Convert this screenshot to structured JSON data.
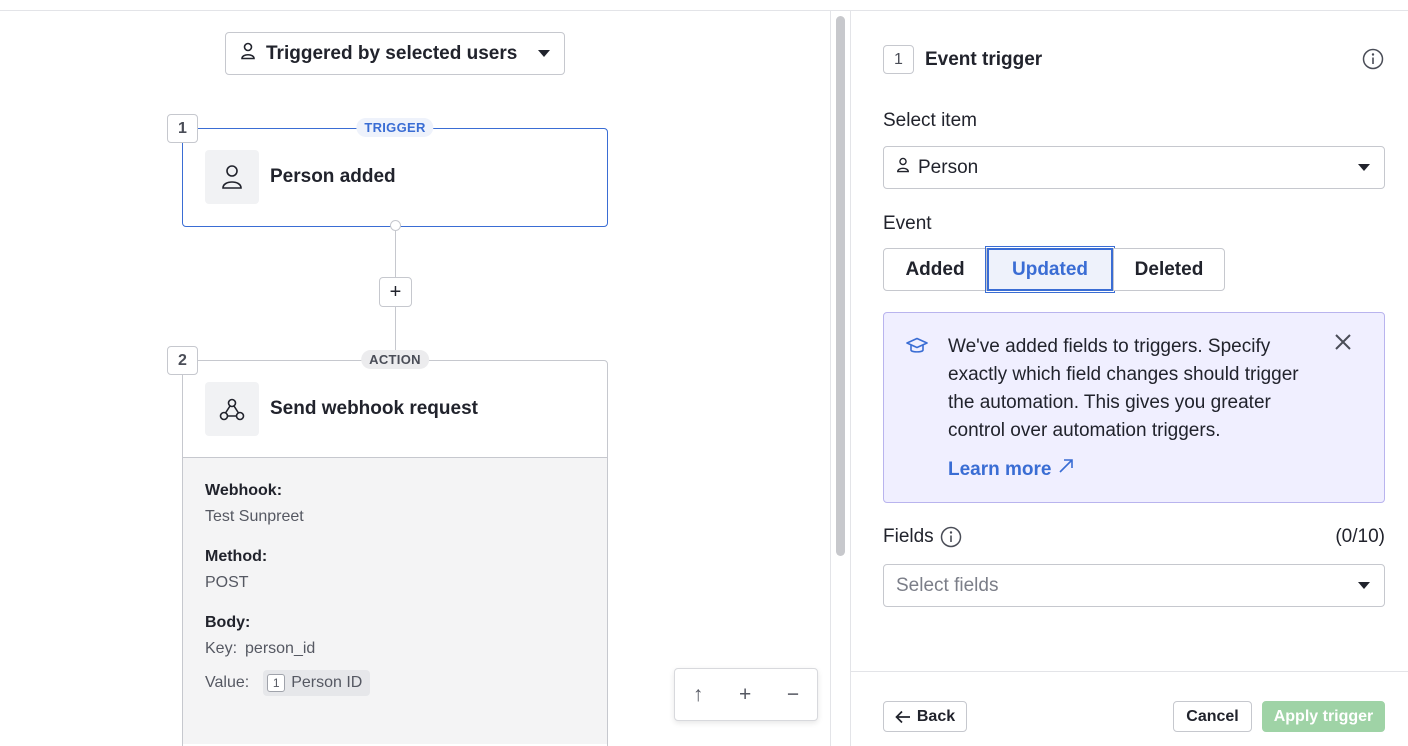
{
  "canvas": {
    "trigger_filter": {
      "label": "Triggered by selected users"
    },
    "steps": [
      {
        "number": "1",
        "type_pill": "TRIGGER",
        "title": "Person added"
      },
      {
        "number": "2",
        "type_pill": "ACTION",
        "title": "Send webhook request",
        "details": {
          "webhook_label": "Webhook:",
          "webhook_value": "Test Sunpreet",
          "method_label": "Method:",
          "method_value": "POST",
          "body_label": "Body:",
          "key_label": "Key:",
          "key_value": "person_id",
          "value_label": "Value:",
          "value_chip_num": "1",
          "value_chip_text": "Person ID"
        }
      }
    ],
    "add_step": "+",
    "zoom": {
      "up": "↑",
      "in": "+",
      "out": "−"
    }
  },
  "panel": {
    "step_number": "1",
    "title": "Event trigger",
    "select_item_label": "Select item",
    "select_item_value": "Person",
    "event_label": "Event",
    "events": [
      "Added",
      "Updated",
      "Deleted"
    ],
    "active_event": "Updated",
    "banner": {
      "text": "We've added fields to triggers. Specify exactly which field changes should trigger the automation. This gives you greater control over automation triggers.",
      "link": "Learn more"
    },
    "fields_label": "Fields",
    "fields_count": "(0/10)",
    "fields_placeholder": "Select fields",
    "footer": {
      "back": "Back",
      "cancel": "Cancel",
      "apply": "Apply trigger"
    }
  },
  "colors": {
    "accent": "#3a6dd4",
    "apply_button": "#9fd3a6",
    "banner_bg": "#f0efff"
  },
  "icons": [
    "person-icon",
    "caret-down-icon",
    "webhook-icon",
    "info-icon",
    "graduation-cap-icon",
    "close-icon",
    "external-link-icon",
    "arrow-left-icon"
  ]
}
